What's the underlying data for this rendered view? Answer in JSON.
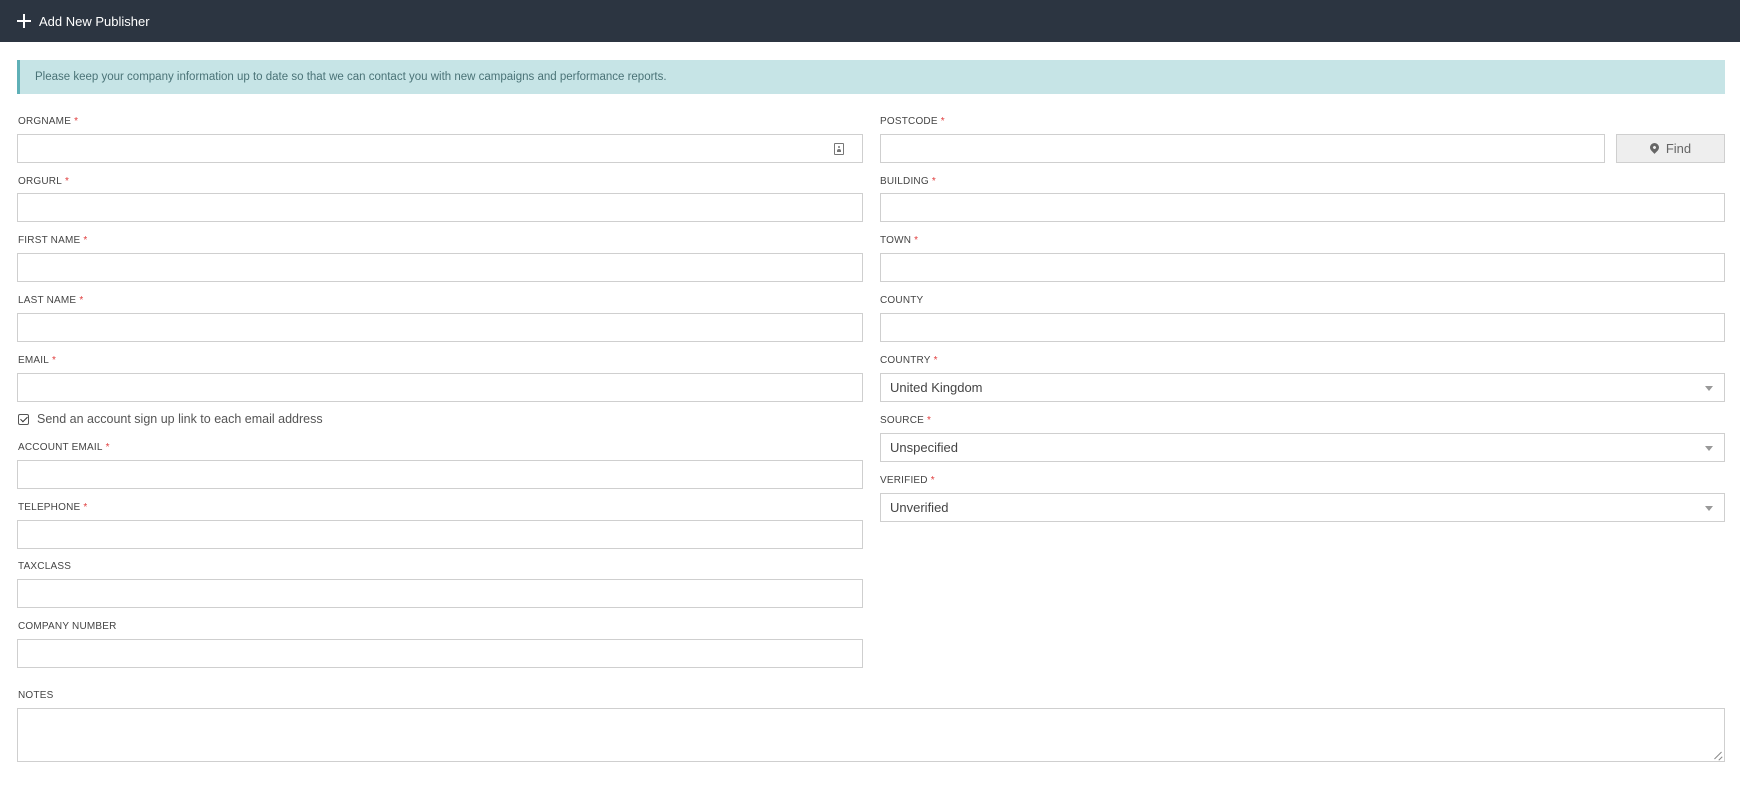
{
  "header": {
    "title": "Add New Publisher"
  },
  "alert": {
    "text": "Please keep your company information up to date so that we can contact you with new campaigns and performance reports."
  },
  "left_fields": {
    "orgname": {
      "label": "ORGNAME",
      "value": ""
    },
    "orgurl": {
      "label": "ORGURL",
      "value": ""
    },
    "first_name": {
      "label": "FIRST NAME",
      "value": ""
    },
    "last_name": {
      "label": "LAST NAME",
      "value": ""
    },
    "email": {
      "label": "EMAIL",
      "value": ""
    },
    "account_email": {
      "label": "ACCOUNT EMAIL",
      "value": ""
    },
    "telephone": {
      "label": "TELEPHONE",
      "value": ""
    },
    "taxclass": {
      "label": "TAXCLASS",
      "value": ""
    },
    "company_number": {
      "label": "COMPANY NUMBER",
      "value": ""
    }
  },
  "checkbox": {
    "label": "Send an account sign up link to each email address",
    "checked": true
  },
  "right_fields": {
    "postcode": {
      "label": "POSTCODE",
      "value": ""
    },
    "building": {
      "label": "BUILDING",
      "value": ""
    },
    "town": {
      "label": "TOWN",
      "value": ""
    },
    "county": {
      "label": "COUNTY",
      "value": ""
    },
    "country": {
      "label": "COUNTRY",
      "value": "United Kingdom"
    },
    "source": {
      "label": "SOURCE",
      "value": "Unspecified"
    },
    "verified": {
      "label": "VERIFIED",
      "value": "Unverified"
    }
  },
  "find_button": {
    "label": "Find",
    "icon": "map-pin-icon"
  },
  "notes": {
    "label": "NOTES",
    "value": ""
  },
  "required_marker": "*",
  "colors": {
    "topbar": "#2c3541",
    "alert_bg": "#c6e4e6",
    "alert_border": "#5fb0b7",
    "required": "#e03c3c"
  }
}
